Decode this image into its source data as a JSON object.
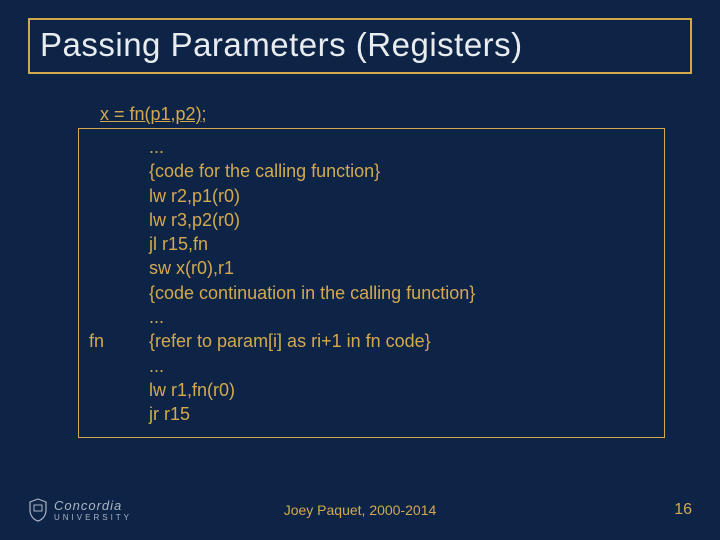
{
  "title": "Passing Parameters (Registers)",
  "source_line": "x = fn(p1,p2);",
  "code": [
    {
      "label": "",
      "text": "..."
    },
    {
      "label": "",
      "text": "{code for the calling function}"
    },
    {
      "label": "",
      "text": "lw r2,p1(r0)"
    },
    {
      "label": "",
      "text": "lw r3,p2(r0)"
    },
    {
      "label": "",
      "text": "jl r15,fn"
    },
    {
      "label": "",
      "text": "sw x(r0),r1"
    },
    {
      "label": "",
      "text": "{code continuation in the calling function}"
    },
    {
      "label": "",
      "text": "..."
    },
    {
      "label": "fn",
      "text": "{refer to param[i] as ri+1 in fn code}"
    },
    {
      "label": "",
      "text": "..."
    },
    {
      "label": "",
      "text": "lw r1,fn(r0)"
    },
    {
      "label": "",
      "text": "jr r15"
    }
  ],
  "footer": {
    "author": "Joey Paquet, 2000-2014",
    "page": "16",
    "brand_top": "Concordia",
    "brand_bot": "UNIVERSITY"
  }
}
